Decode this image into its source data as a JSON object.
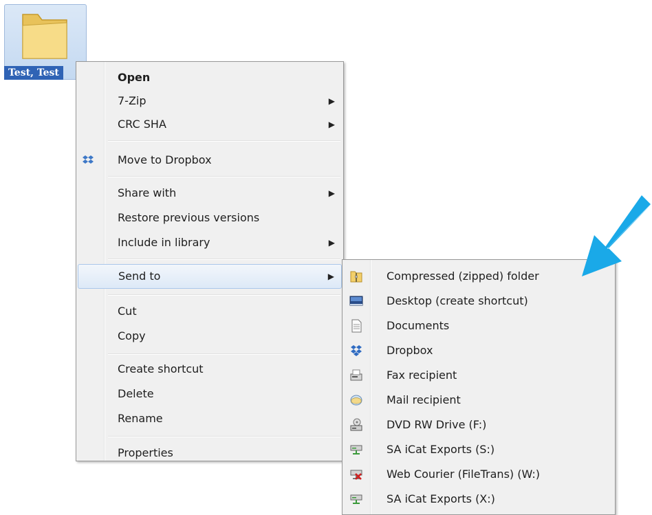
{
  "desktop": {
    "folder_label": "Test, Test"
  },
  "context_menu": {
    "items": [
      {
        "label": "Open",
        "bold": true
      },
      {
        "label": "7-Zip",
        "submenu": true
      },
      {
        "label": "CRC SHA",
        "submenu": true
      },
      {
        "label": "Move to Dropbox",
        "icon": "dropbox-icon"
      },
      {
        "label": "Share with",
        "submenu": true
      },
      {
        "label": "Restore previous versions"
      },
      {
        "label": "Include in library",
        "submenu": true
      },
      {
        "label": "Send to",
        "submenu": true,
        "highlighted": true
      },
      {
        "label": "Cut"
      },
      {
        "label": "Copy"
      },
      {
        "label": "Create shortcut"
      },
      {
        "label": "Delete"
      },
      {
        "label": "Rename"
      },
      {
        "label": "Properties"
      }
    ]
  },
  "send_to_menu": {
    "items": [
      {
        "label": "Compressed (zipped) folder",
        "icon": "zip-folder-icon"
      },
      {
        "label": "Desktop (create shortcut)",
        "icon": "desktop-icon"
      },
      {
        "label": "Documents",
        "icon": "document-icon"
      },
      {
        "label": "Dropbox",
        "icon": "dropbox-icon"
      },
      {
        "label": "Fax recipient",
        "icon": "fax-icon"
      },
      {
        "label": "Mail recipient",
        "icon": "mail-icon"
      },
      {
        "label": "DVD RW Drive (F:)",
        "icon": "dvd-drive-icon"
      },
      {
        "label": "SA iCat Exports (S:)",
        "icon": "network-drive-icon"
      },
      {
        "label": "Web Courier (FileTrans) (W:)",
        "icon": "disconnected-drive-icon"
      },
      {
        "label": "SA iCat Exports (X:)",
        "icon": "network-drive-icon"
      }
    ]
  },
  "colors": {
    "callout_arrow": "#1aa9e8",
    "menu_background": "#f0f0f0",
    "highlight_border": "#a9c6ea"
  }
}
